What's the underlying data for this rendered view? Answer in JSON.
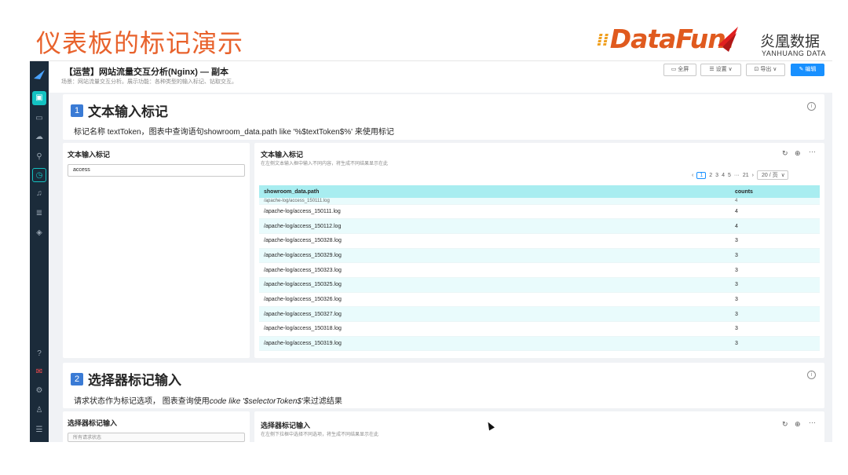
{
  "slide": {
    "title": "仪表板的标记演示",
    "logo_text": "DataFun.",
    "logo_yh_cn": "炎凰数据",
    "logo_yh_en": "YANHUANG DATA",
    "accent": "#e8622c"
  },
  "dashboard": {
    "title": "【运营】网站流量交互分析(Nginx) — 副本",
    "subtitle": "场景：网站流量交互分析。展示功能：各种类型的输入标记、钻取交互。",
    "buttons": {
      "fullscreen": "全屏",
      "settings": "设置",
      "export": "导出",
      "edit": "编辑"
    }
  },
  "sidebar": {
    "icons": [
      "dashboard-icon",
      "monitor-icon",
      "cloud-icon",
      "search-icon",
      "clock-icon",
      "bell-icon",
      "database-icon",
      "layers-icon",
      "help-icon",
      "message-icon",
      "settings-icon",
      "user-icon",
      "menu-icon"
    ]
  },
  "section1": {
    "number": "1",
    "title": "文本输入标记",
    "desc": "标记名称 textToken，图表中查询语句showroom_data.path like '%$textToken$%'  来使用标记",
    "input_panel_title": "文本输入标记",
    "input_value": "access",
    "table_panel_title": "文本输入标记",
    "table_panel_sub": "在左侧文本输入框中输入不同内容，将生成不同结果显示在此",
    "pager": {
      "pages": [
        "1",
        "2",
        "3",
        "4",
        "5"
      ],
      "ellipsis": "···",
      "last": "21",
      "page_size": "20 / 页"
    },
    "columns": [
      "showroom_data.path",
      "counts"
    ],
    "partial_row": {
      "path": "/apache-log/access_150111.log",
      "count": "4"
    },
    "rows": [
      {
        "path": "/apache-log/access_150111.log",
        "count": "4"
      },
      {
        "path": "/apache-log/access_150112.log",
        "count": "4"
      },
      {
        "path": "/apache-log/access_150328.log",
        "count": "3"
      },
      {
        "path": "/apache-log/access_150329.log",
        "count": "3"
      },
      {
        "path": "/apache-log/access_150323.log",
        "count": "3"
      },
      {
        "path": "/apache-log/access_150325.log",
        "count": "3"
      },
      {
        "path": "/apache-log/access_150326.log",
        "count": "3"
      },
      {
        "path": "/apache-log/access_150327.log",
        "count": "3"
      },
      {
        "path": "/apache-log/access_150318.log",
        "count": "3"
      },
      {
        "path": "/apache-log/access_150319.log",
        "count": "3"
      }
    ]
  },
  "section2": {
    "number": "2",
    "title": "选择器标记输入",
    "desc_prefix": "请求状态作为标记选项， 图表查询使用",
    "desc_code": "code like '$selectorToken$'",
    "desc_suffix": "来过滤结果",
    "input_panel_title": "选择器标记输入",
    "select_placeholder": "所有请求状态",
    "chart_panel_title": "选择器标记输入",
    "chart_panel_sub": "在左侧下拉框中选择不同选项，将生成不同结果显示在此"
  }
}
